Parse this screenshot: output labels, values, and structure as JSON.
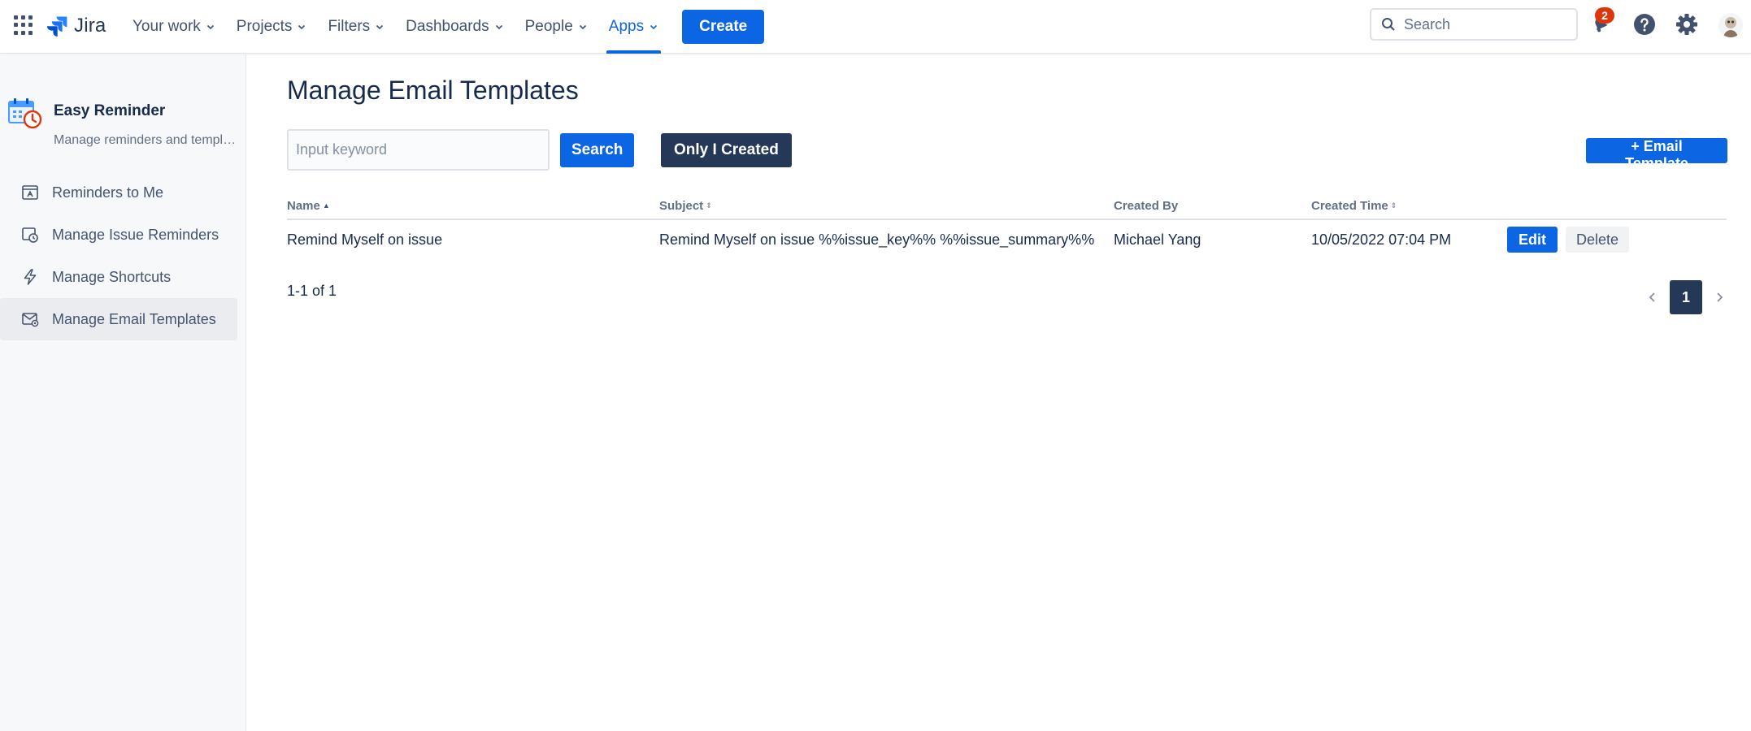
{
  "topnav": {
    "logo_text": "Jira",
    "items": [
      {
        "label": "Your work"
      },
      {
        "label": "Projects"
      },
      {
        "label": "Filters"
      },
      {
        "label": "Dashboards"
      },
      {
        "label": "People"
      },
      {
        "label": "Apps",
        "active": true
      }
    ],
    "create_label": "Create",
    "search_placeholder": "Search",
    "notification_count": "2",
    "accent_color": "#0c66e4"
  },
  "sidebar": {
    "app_title": "Easy Reminder",
    "app_subtitle": "Manage reminders and templates",
    "items": [
      {
        "label": "Reminders to Me",
        "icon": "calendar-alarm-icon"
      },
      {
        "label": "Manage Issue Reminders",
        "icon": "clock-reminder-icon"
      },
      {
        "label": "Manage Shortcuts",
        "icon": "lightning-icon"
      },
      {
        "label": "Manage Email Templates",
        "icon": "email-template-icon",
        "active": true
      }
    ]
  },
  "main": {
    "title": "Manage Email Templates",
    "keyword_placeholder": "Input keyword",
    "search_label": "Search",
    "only_i_created_label": "Only I Created",
    "add_template_label": "+ Email Template",
    "columns": {
      "name": "Name",
      "subject": "Subject",
      "created_by": "Created By",
      "created_time": "Created Time"
    },
    "rows": [
      {
        "name": "Remind Myself on issue",
        "subject": "Remind Myself on issue %%issue_key%% %%issue_summary%%",
        "created_by": "Michael Yang",
        "created_time": "10/05/2022 07:04 PM",
        "edit_label": "Edit",
        "delete_label": "Delete"
      }
    ],
    "count_text": "1-1 of 1",
    "current_page": "1"
  }
}
